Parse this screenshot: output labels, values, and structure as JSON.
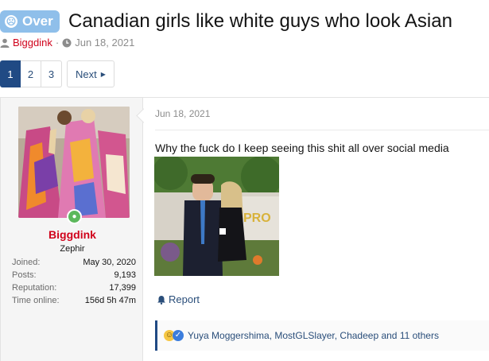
{
  "thread": {
    "prefix": "Over",
    "title": "Canadian girls like white guys who look Asian",
    "author": "Biggdink",
    "date": "Jun 18, 2021"
  },
  "pagination": {
    "pages": [
      "1",
      "2",
      "3"
    ],
    "current": "1",
    "next_label": "Next"
  },
  "post": {
    "user": {
      "name": "Biggdink",
      "title": "Zephir",
      "stats": [
        {
          "label": "Joined:",
          "value": "May 30, 2020"
        },
        {
          "label": "Posts:",
          "value": "9,193"
        },
        {
          "label": "Reputation:",
          "value": "17,399"
        },
        {
          "label": "Time online:",
          "value": "156d 5h 47m"
        }
      ]
    },
    "date": "Jun 18, 2021",
    "body": "Why the fuck do I keep seeing this shit all over social media",
    "report_label": "Report",
    "reactions_text": "Yuya Moggershima, MostGLSlayer, Chadeep and 11 others"
  },
  "colors": {
    "accent": "#204a84",
    "username": "#d0021b",
    "prefix_badge": "#8fbfea",
    "link": "#2a4e7a"
  },
  "icons": [
    "sad-face-icon",
    "user-icon",
    "clock-icon",
    "chevron-right-icon",
    "online-status-icon",
    "bell-icon",
    "laugh-reaction-icon",
    "like-reaction-icon"
  ]
}
